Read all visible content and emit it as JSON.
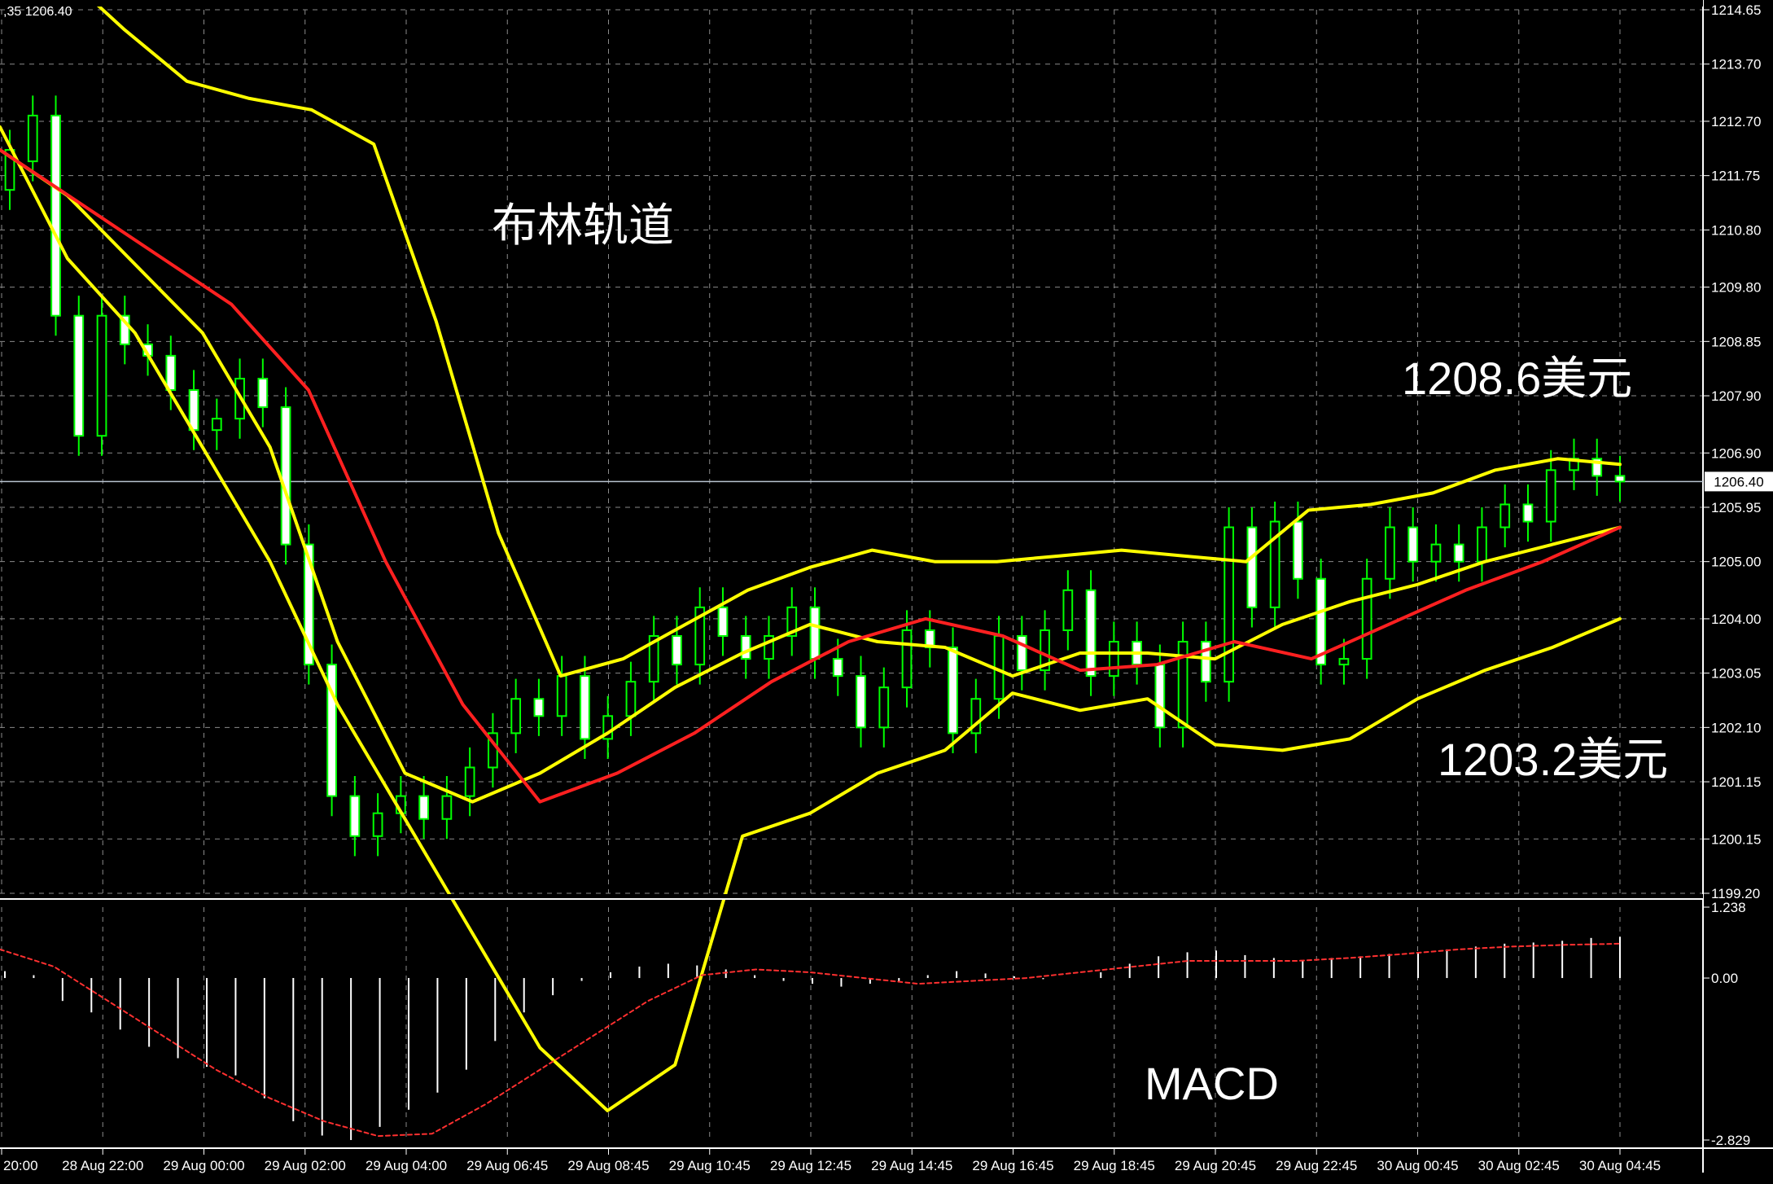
{
  "header": {
    "text": ",35 1206.40"
  },
  "annotations": {
    "bollinger": "布林轨道",
    "upper_level": "1208.6美元",
    "lower_level": "1203.2美元",
    "macd": "MACD"
  },
  "colors": {
    "background": "#000000",
    "grid": "#8a8a8a",
    "bull_candle": "#00ff00",
    "bear_candle_body": "#ffffff",
    "bollinger_band": "#ffff00",
    "moving_average": "#ff2020",
    "macd_hist": "#ffffff",
    "macd_signal": "#ff3030",
    "axis_text": "#ffffff"
  },
  "chart_data": [
    {
      "type": "candlestick",
      "title": "",
      "current_price": 1206.4,
      "ylim": [
        1199.2,
        1214.65
      ],
      "y_ticks": [
        "1214.65",
        "1213.70",
        "1212.70",
        "1211.75",
        "1210.80",
        "1209.80",
        "1208.85",
        "1207.90",
        "1206.90",
        "1205.95",
        "1205.00",
        "1204.00",
        "1203.05",
        "1202.10",
        "1201.15",
        "1200.15",
        "1199.20"
      ],
      "x_ticks": [
        "20:00",
        "28 Aug 22:00",
        "29 Aug 00:00",
        "29 Aug 02:00",
        "29 Aug 04:00",
        "29 Aug 06:45",
        "29 Aug 08:45",
        "29 Aug 10:45",
        "29 Aug 12:45",
        "29 Aug 14:45",
        "29 Aug 16:45",
        "29 Aug 18:45",
        "29 Aug 20:45",
        "29 Aug 22:45",
        "30 Aug 00:45",
        "30 Aug 02:45",
        "30 Aug 04:45"
      ],
      "price_label": "1206.40",
      "bollinger_upper": [
        1214.9,
        1215.3,
        1214.3,
        1213.4,
        1213.1,
        1212.9,
        1212.3,
        1209.2,
        1205.5,
        1203.0,
        1203.3,
        1203.9,
        1204.5,
        1204.9,
        1205.2,
        1205.0,
        1205.0,
        1205.1,
        1205.2,
        1205.1,
        1205.0,
        1205.9,
        1206.0,
        1206.2,
        1206.6,
        1206.8,
        1206.7
      ],
      "bollinger_middle": [
        1212.2,
        1211.4,
        1210.2,
        1209.0,
        1207.0,
        1203.6,
        1201.3,
        1200.8,
        1201.3,
        1202.0,
        1202.8,
        1203.4,
        1203.9,
        1203.6,
        1203.5,
        1203.0,
        1203.4,
        1203.4,
        1203.3,
        1203.9,
        1204.3,
        1204.6,
        1205.0,
        1205.3,
        1205.6
      ],
      "bollinger_lower": [
        1212.6,
        1210.3,
        1209.0,
        1207.0,
        1205.0,
        1202.5,
        1200.5,
        1198.5,
        1196.5,
        1195.4,
        1196.2,
        1200.2,
        1200.6,
        1201.3,
        1201.7,
        1202.7,
        1202.4,
        1202.6,
        1201.8,
        1201.7,
        1201.9,
        1202.6,
        1203.1,
        1203.5,
        1204.0
      ],
      "moving_average": [
        1212.2,
        1211.3,
        1210.4,
        1209.5,
        1208.0,
        1205.0,
        1202.5,
        1200.8,
        1201.3,
        1202.0,
        1202.9,
        1203.6,
        1204.0,
        1203.7,
        1203.1,
        1203.2,
        1203.6,
        1203.3,
        1203.9,
        1204.5,
        1205.0,
        1205.6
      ],
      "candles": [
        {
          "o": 1211.5,
          "c": 1212.2
        },
        {
          "o": 1212.0,
          "c": 1212.8
        },
        {
          "o": 1212.8,
          "c": 1209.3
        },
        {
          "o": 1209.3,
          "c": 1207.2
        },
        {
          "o": 1207.2,
          "c": 1209.3
        },
        {
          "o": 1209.3,
          "c": 1208.8
        },
        {
          "o": 1208.8,
          "c": 1208.6
        },
        {
          "o": 1208.6,
          "c": 1208.0
        },
        {
          "o": 1208.0,
          "c": 1207.3
        },
        {
          "o": 1207.3,
          "c": 1207.5
        },
        {
          "o": 1207.5,
          "c": 1208.2
        },
        {
          "o": 1208.2,
          "c": 1207.7
        },
        {
          "o": 1207.7,
          "c": 1205.3
        },
        {
          "o": 1205.3,
          "c": 1203.2
        },
        {
          "o": 1203.2,
          "c": 1200.9
        },
        {
          "o": 1200.9,
          "c": 1200.2
        },
        {
          "o": 1200.2,
          "c": 1200.6
        },
        {
          "o": 1200.6,
          "c": 1200.9
        },
        {
          "o": 1200.9,
          "c": 1200.5
        },
        {
          "o": 1200.5,
          "c": 1200.9
        },
        {
          "o": 1200.9,
          "c": 1201.4
        },
        {
          "o": 1201.4,
          "c": 1202.0
        },
        {
          "o": 1202.0,
          "c": 1202.6
        },
        {
          "o": 1202.6,
          "c": 1202.3
        },
        {
          "o": 1202.3,
          "c": 1203.0
        },
        {
          "o": 1203.0,
          "c": 1201.9
        },
        {
          "o": 1201.9,
          "c": 1202.3
        },
        {
          "o": 1202.3,
          "c": 1202.9
        },
        {
          "o": 1202.9,
          "c": 1203.7
        },
        {
          "o": 1203.7,
          "c": 1203.2
        },
        {
          "o": 1203.2,
          "c": 1204.2
        },
        {
          "o": 1204.2,
          "c": 1203.7
        },
        {
          "o": 1203.7,
          "c": 1203.3
        },
        {
          "o": 1203.3,
          "c": 1203.7
        },
        {
          "o": 1203.7,
          "c": 1204.2
        },
        {
          "o": 1204.2,
          "c": 1203.3
        },
        {
          "o": 1203.3,
          "c": 1203.0
        },
        {
          "o": 1203.0,
          "c": 1202.1
        },
        {
          "o": 1202.1,
          "c": 1202.8
        },
        {
          "o": 1202.8,
          "c": 1203.8
        },
        {
          "o": 1203.8,
          "c": 1203.5
        },
        {
          "o": 1203.5,
          "c": 1202.0
        },
        {
          "o": 1202.0,
          "c": 1202.6
        },
        {
          "o": 1202.6,
          "c": 1203.7
        },
        {
          "o": 1203.7,
          "c": 1203.1
        },
        {
          "o": 1203.1,
          "c": 1203.8
        },
        {
          "o": 1203.8,
          "c": 1204.5
        },
        {
          "o": 1204.5,
          "c": 1203.0
        },
        {
          "o": 1203.0,
          "c": 1203.6
        },
        {
          "o": 1203.6,
          "c": 1203.2
        },
        {
          "o": 1203.2,
          "c": 1202.1
        },
        {
          "o": 1202.1,
          "c": 1203.6
        },
        {
          "o": 1203.6,
          "c": 1202.9
        },
        {
          "o": 1202.9,
          "c": 1205.6
        },
        {
          "o": 1205.6,
          "c": 1204.2
        },
        {
          "o": 1204.2,
          "c": 1205.7
        },
        {
          "o": 1205.7,
          "c": 1204.7
        },
        {
          "o": 1204.7,
          "c": 1203.2
        },
        {
          "o": 1203.2,
          "c": 1203.3
        },
        {
          "o": 1203.3,
          "c": 1204.7
        },
        {
          "o": 1204.7,
          "c": 1205.6
        },
        {
          "o": 1205.6,
          "c": 1205.0
        },
        {
          "o": 1205.0,
          "c": 1205.3
        },
        {
          "o": 1205.3,
          "c": 1205.0
        },
        {
          "o": 1205.0,
          "c": 1205.6
        },
        {
          "o": 1205.6,
          "c": 1206.0
        },
        {
          "o": 1206.0,
          "c": 1205.7
        },
        {
          "o": 1205.7,
          "c": 1206.6
        },
        {
          "o": 1206.6,
          "c": 1206.8
        },
        {
          "o": 1206.8,
          "c": 1206.5
        },
        {
          "o": 1206.5,
          "c": 1206.4
        }
      ]
    },
    {
      "type": "bar",
      "title": "",
      "name": "MACD",
      "ylim": [
        -2.829,
        1.238
      ],
      "y_ticks": [
        "1.238",
        "0.00",
        "-2.829"
      ],
      "histogram": [
        0.12,
        0.05,
        -0.4,
        -0.6,
        -0.9,
        -1.2,
        -1.4,
        -1.55,
        -1.7,
        -2.1,
        -2.5,
        -2.75,
        -2.829,
        -2.6,
        -2.3,
        -2.0,
        -1.6,
        -1.1,
        -0.6,
        -0.3,
        -0.05,
        0.1,
        0.2,
        0.25,
        0.22,
        0.15,
        0.05,
        -0.05,
        -0.1,
        -0.15,
        -0.1,
        -0.05,
        0.05,
        0.12,
        0.08,
        0.03,
        -0.02,
        0.0,
        0.1,
        0.25,
        0.38,
        0.45,
        0.48,
        0.4,
        0.35,
        0.3,
        0.35,
        0.38,
        0.42,
        0.45,
        0.5,
        0.55,
        0.6,
        0.62,
        0.65,
        0.7,
        0.72
      ],
      "signal": [
        0.5,
        0.2,
        -0.4,
        -1.0,
        -1.6,
        -2.1,
        -2.5,
        -2.76,
        -2.72,
        -2.2,
        -1.6,
        -1.0,
        -0.4,
        0.05,
        0.15,
        0.1,
        0.0,
        -0.1,
        -0.05,
        0.0,
        0.1,
        0.2,
        0.3,
        0.3,
        0.3,
        0.35,
        0.42,
        0.5,
        0.55,
        0.58,
        0.6
      ]
    }
  ]
}
